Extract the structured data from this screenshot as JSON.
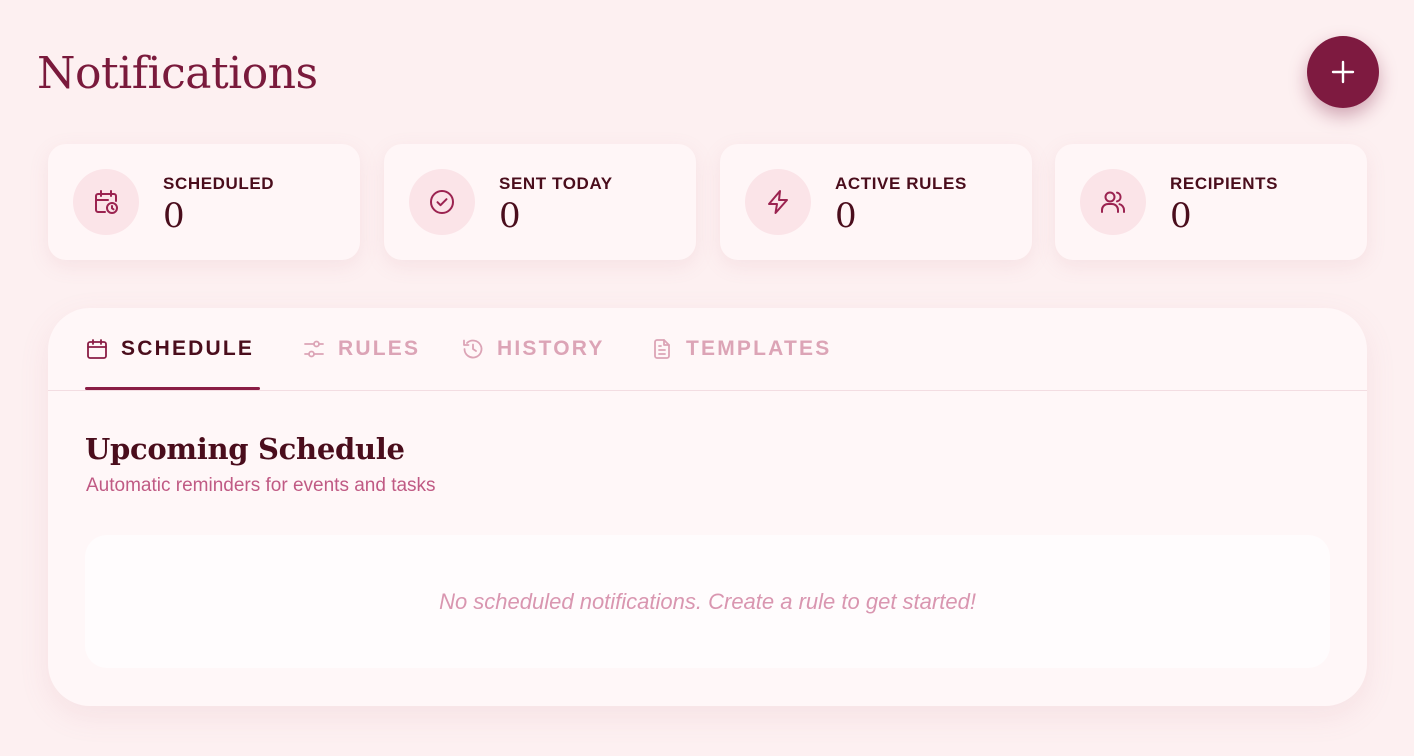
{
  "header": {
    "title": "Notifications",
    "add_button_icon": "plus-icon"
  },
  "stats": [
    {
      "label": "SCHEDULED",
      "value": "0",
      "icon": "calendar-clock-icon"
    },
    {
      "label": "SENT TODAY",
      "value": "0",
      "icon": "check-circle-icon"
    },
    {
      "label": "ACTIVE RULES",
      "value": "0",
      "icon": "lightning-icon"
    },
    {
      "label": "RECIPIENTS",
      "value": "0",
      "icon": "users-icon"
    }
  ],
  "tabs": [
    {
      "label": "SCHEDULE",
      "icon": "calendar-icon",
      "active": true
    },
    {
      "label": "RULES",
      "icon": "sliders-icon",
      "active": false
    },
    {
      "label": "HISTORY",
      "icon": "history-icon",
      "active": false
    },
    {
      "label": "TEMPLATES",
      "icon": "document-icon",
      "active": false
    }
  ],
  "schedule": {
    "title": "Upcoming Schedule",
    "subtitle": "Automatic reminders for events and tasks",
    "empty_message": "No scheduled notifications. Create a rule to get started!"
  },
  "colors": {
    "background": "#fdf0f1",
    "accent": "#7e1a40",
    "text_dark": "#4a0d1c",
    "muted_pink": "#dca4b6"
  }
}
